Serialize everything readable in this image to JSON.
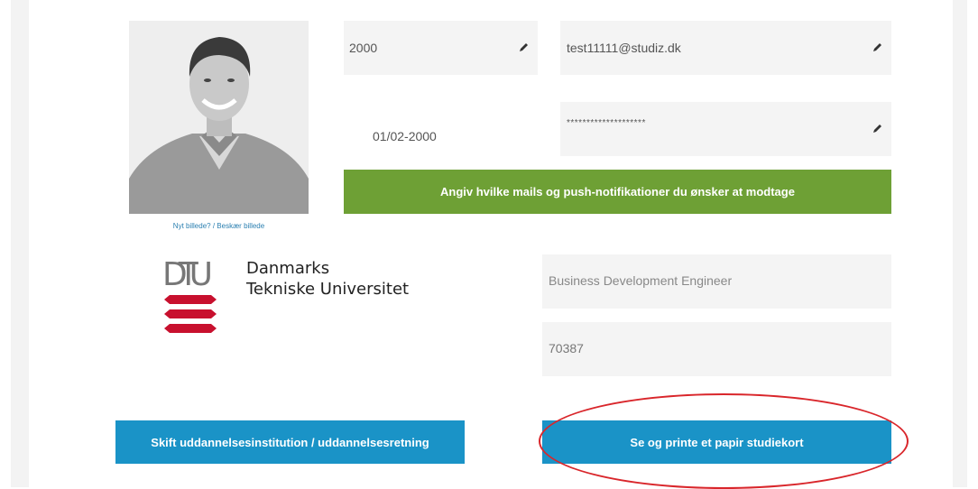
{
  "profile": {
    "photo_links": {
      "new_photo": "Nyt billede?",
      "separator": " / ",
      "crop_photo": "Beskær billede"
    }
  },
  "fields": {
    "zip": "2000",
    "email": "test11111@studiz.dk",
    "birthdate": "01/02-2000",
    "password": "********************",
    "job_title": "Business Development Engineer",
    "student_number": "70387"
  },
  "buttons": {
    "notifications": "Angiv hvilke mails og push-notifikationer du ønsker at modtage",
    "switch_institution": "Skift uddannelsesinstitution / uddannelsesretning",
    "print_card": "Se og printe et papir studiekort"
  },
  "institution": {
    "logo_text": "DTU",
    "name_line1": "Danmarks",
    "name_line2": "Tekniske Universitet"
  },
  "colors": {
    "green": "#6ea035",
    "blue": "#1a93c7",
    "dtu_red": "#c8102e",
    "annotation_red": "#d9262b"
  }
}
